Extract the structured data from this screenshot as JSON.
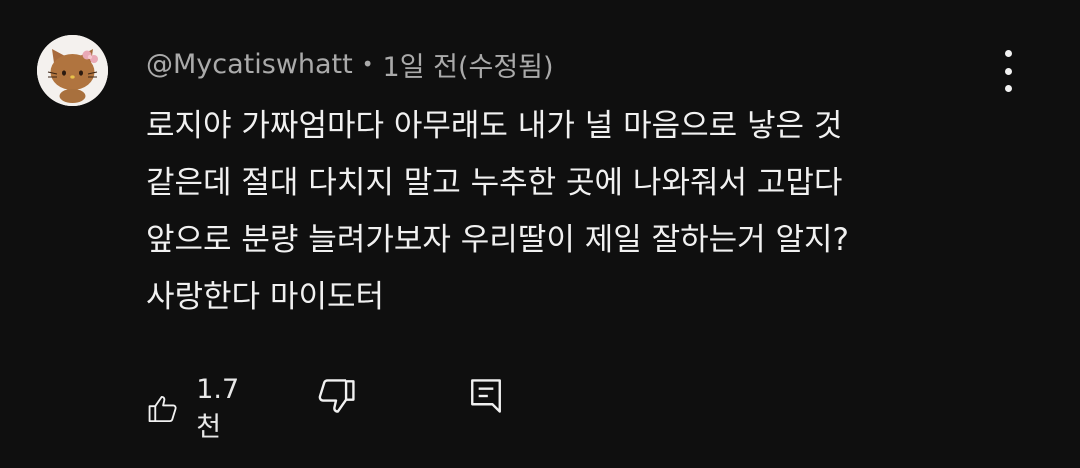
{
  "comment": {
    "author": "@Mycatiswhatt",
    "separator": "•",
    "time": "1일 전(수정됨)",
    "body_lines": [
      "로지야 가짜엄마다 아무래도 내가 널 마음으로 낳은 것",
      "같은데 절대 다치지 말고 누추한 곳에 나와줘서 고맙다",
      "앞으로 분량 늘려가보자 우리딸이 제일 잘하는거 알지?",
      "사랑한다 마이도터"
    ],
    "like_count": "1.7천"
  },
  "icons": {
    "avatar": "hello-kitty-avatar",
    "menu": "more-vertical-icon",
    "like": "thumbs-up-icon",
    "dislike": "thumbs-down-icon",
    "reply": "comment-reply-icon"
  },
  "colors": {
    "background": "#0f0f0f",
    "text_primary": "#f1f1f1",
    "text_secondary": "#aaaaaa"
  }
}
